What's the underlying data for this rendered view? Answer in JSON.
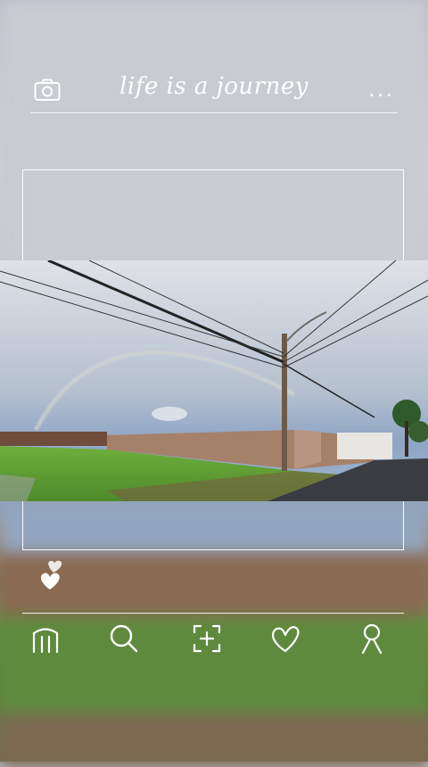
{
  "header": {
    "title": "life is a journey",
    "more_label": "...",
    "camera_icon": "camera-icon"
  },
  "post": {
    "photo_alt": "rainbow over field with power lines",
    "like_icon": "double-heart-icon"
  },
  "nav": {
    "items": [
      {
        "icon": "home-icon"
      },
      {
        "icon": "search-icon"
      },
      {
        "icon": "add-post-icon"
      },
      {
        "icon": "heart-icon"
      },
      {
        "icon": "profile-icon"
      }
    ]
  },
  "colors": {
    "overlay_line": "#ffffff",
    "grass": "#5f9b35",
    "sky": "#c8ced6"
  }
}
